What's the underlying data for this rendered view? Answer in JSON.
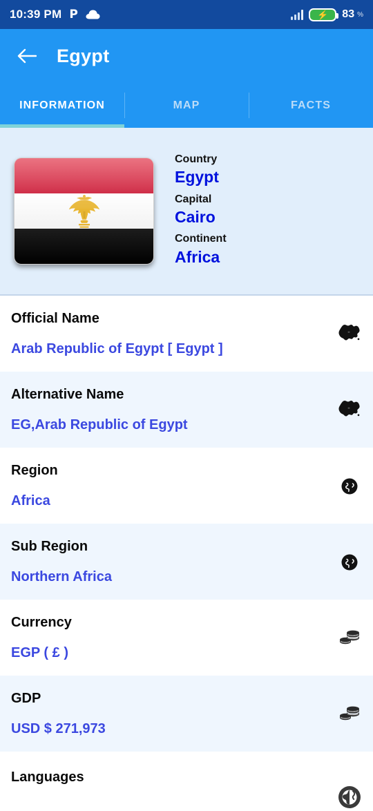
{
  "status_bar": {
    "time": "10:39 PM",
    "app_icon": "P",
    "icons": [
      "pinterest-icon",
      "cloud-icon",
      "signal-icon",
      "battery-charging-icon"
    ],
    "battery_percent": "83",
    "percent_symbol": "%",
    "background_color": "#124a9e"
  },
  "app_bar": {
    "back_label": "←",
    "title": "Egypt",
    "background_color": "#2196f3"
  },
  "tabs": {
    "items": [
      {
        "label": "INFORMATION",
        "active": true
      },
      {
        "label": "MAP",
        "active": false
      },
      {
        "label": "FACTS",
        "active": false
      }
    ],
    "indicator_color": "#7fd3d8"
  },
  "header_card": {
    "flag_alt": "Flag of Egypt",
    "background_color": "#e1eefb",
    "fields": [
      {
        "label": "Country",
        "value": "Egypt"
      },
      {
        "label": "Capital",
        "value": "Cairo"
      },
      {
        "label": "Continent",
        "value": "Africa"
      }
    ],
    "value_color": "#0011dd"
  },
  "info_list": {
    "value_color": "#3b48e0",
    "rows": [
      {
        "label": "Official Name",
        "value": "Arab Republic of Egypt [ Egypt ]",
        "icon": "map-shape-icon",
        "alt": false
      },
      {
        "label": "Alternative Name",
        "value": "EG,Arab Republic of Egypt",
        "icon": "map-shape-icon",
        "alt": true
      },
      {
        "label": "Region",
        "value": "Africa",
        "icon": "globe-icon",
        "alt": false
      },
      {
        "label": "Sub Region",
        "value": "Northern Africa",
        "icon": "globe-icon",
        "alt": true
      },
      {
        "label": "Currency",
        "value": "EGP ( £ )",
        "icon": "coins-icon",
        "alt": false
      },
      {
        "label": "GDP",
        "value": "USD $ 271,973",
        "icon": "coins-icon",
        "alt": true
      },
      {
        "label": "Languages",
        "value": "",
        "icon": "globe-circle-icon",
        "alt": false
      }
    ]
  }
}
